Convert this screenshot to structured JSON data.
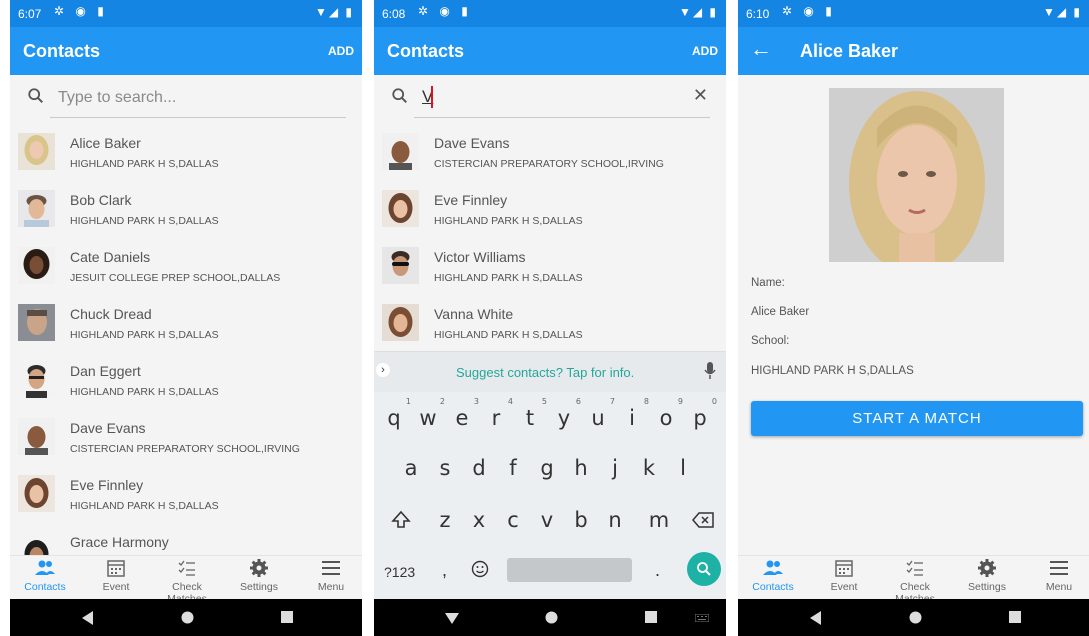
{
  "screen1": {
    "status_time": "6:07",
    "title": "Contacts",
    "add_label": "ADD",
    "search_placeholder": "Type to search...",
    "contacts": [
      {
        "name": "Alice Baker",
        "school": "HIGHLAND PARK H S,DALLAS"
      },
      {
        "name": "Bob Clark",
        "school": "HIGHLAND PARK H S,DALLAS"
      },
      {
        "name": "Cate Daniels",
        "school": "JESUIT COLLEGE PREP SCHOOL,DALLAS"
      },
      {
        "name": "Chuck Dread",
        "school": "HIGHLAND PARK H S,DALLAS"
      },
      {
        "name": "Dan Eggert",
        "school": "HIGHLAND PARK H S,DALLAS"
      },
      {
        "name": "Dave Evans",
        "school": "CISTERCIAN PREPARATORY SCHOOL,IRVING"
      },
      {
        "name": "Eve Finnley",
        "school": "HIGHLAND PARK H S,DALLAS"
      },
      {
        "name": "Grace Harmony",
        "school": ""
      }
    ]
  },
  "screen2": {
    "status_time": "6:08",
    "title": "Contacts",
    "add_label": "ADD",
    "search_value": "V",
    "contacts": [
      {
        "name": "Dave Evans",
        "school": "CISTERCIAN PREPARATORY SCHOOL,IRVING"
      },
      {
        "name": "Eve Finnley",
        "school": "HIGHLAND PARK H S,DALLAS"
      },
      {
        "name": "Victor Williams",
        "school": "HIGHLAND PARK H S,DALLAS"
      },
      {
        "name": "Vanna White",
        "school": "HIGHLAND PARK H S,DALLAS"
      }
    ],
    "keyboard": {
      "suggestion": "Suggest contacts? Tap for info.",
      "row1": [
        "q",
        "w",
        "e",
        "r",
        "t",
        "y",
        "u",
        "i",
        "o",
        "p"
      ],
      "row1_hints": [
        "1",
        "2",
        "3",
        "4",
        "5",
        "6",
        "7",
        "8",
        "9",
        "0"
      ],
      "row2": [
        "a",
        "s",
        "d",
        "f",
        "g",
        "h",
        "j",
        "k",
        "l"
      ],
      "row3": [
        "z",
        "x",
        "c",
        "v",
        "b",
        "n",
        "m"
      ],
      "symbols_key": "?123",
      "comma": ",",
      "period": "."
    }
  },
  "screen3": {
    "status_time": "6:10",
    "title": "Alice Baker",
    "name_label": "Name:",
    "name_value": "Alice Baker",
    "school_label": "School:",
    "school_value": "HIGHLAND PARK H S,DALLAS",
    "start_match_label": "START A MATCH"
  },
  "nav": {
    "contacts": "Contacts",
    "event": "Event",
    "check_matches": "Check Matches",
    "settings": "Settings",
    "menu": "Menu"
  },
  "colors": {
    "app_bar": "#2196f3",
    "status_bar": "#1585e3",
    "accent_teal": "#1eb2a6"
  }
}
